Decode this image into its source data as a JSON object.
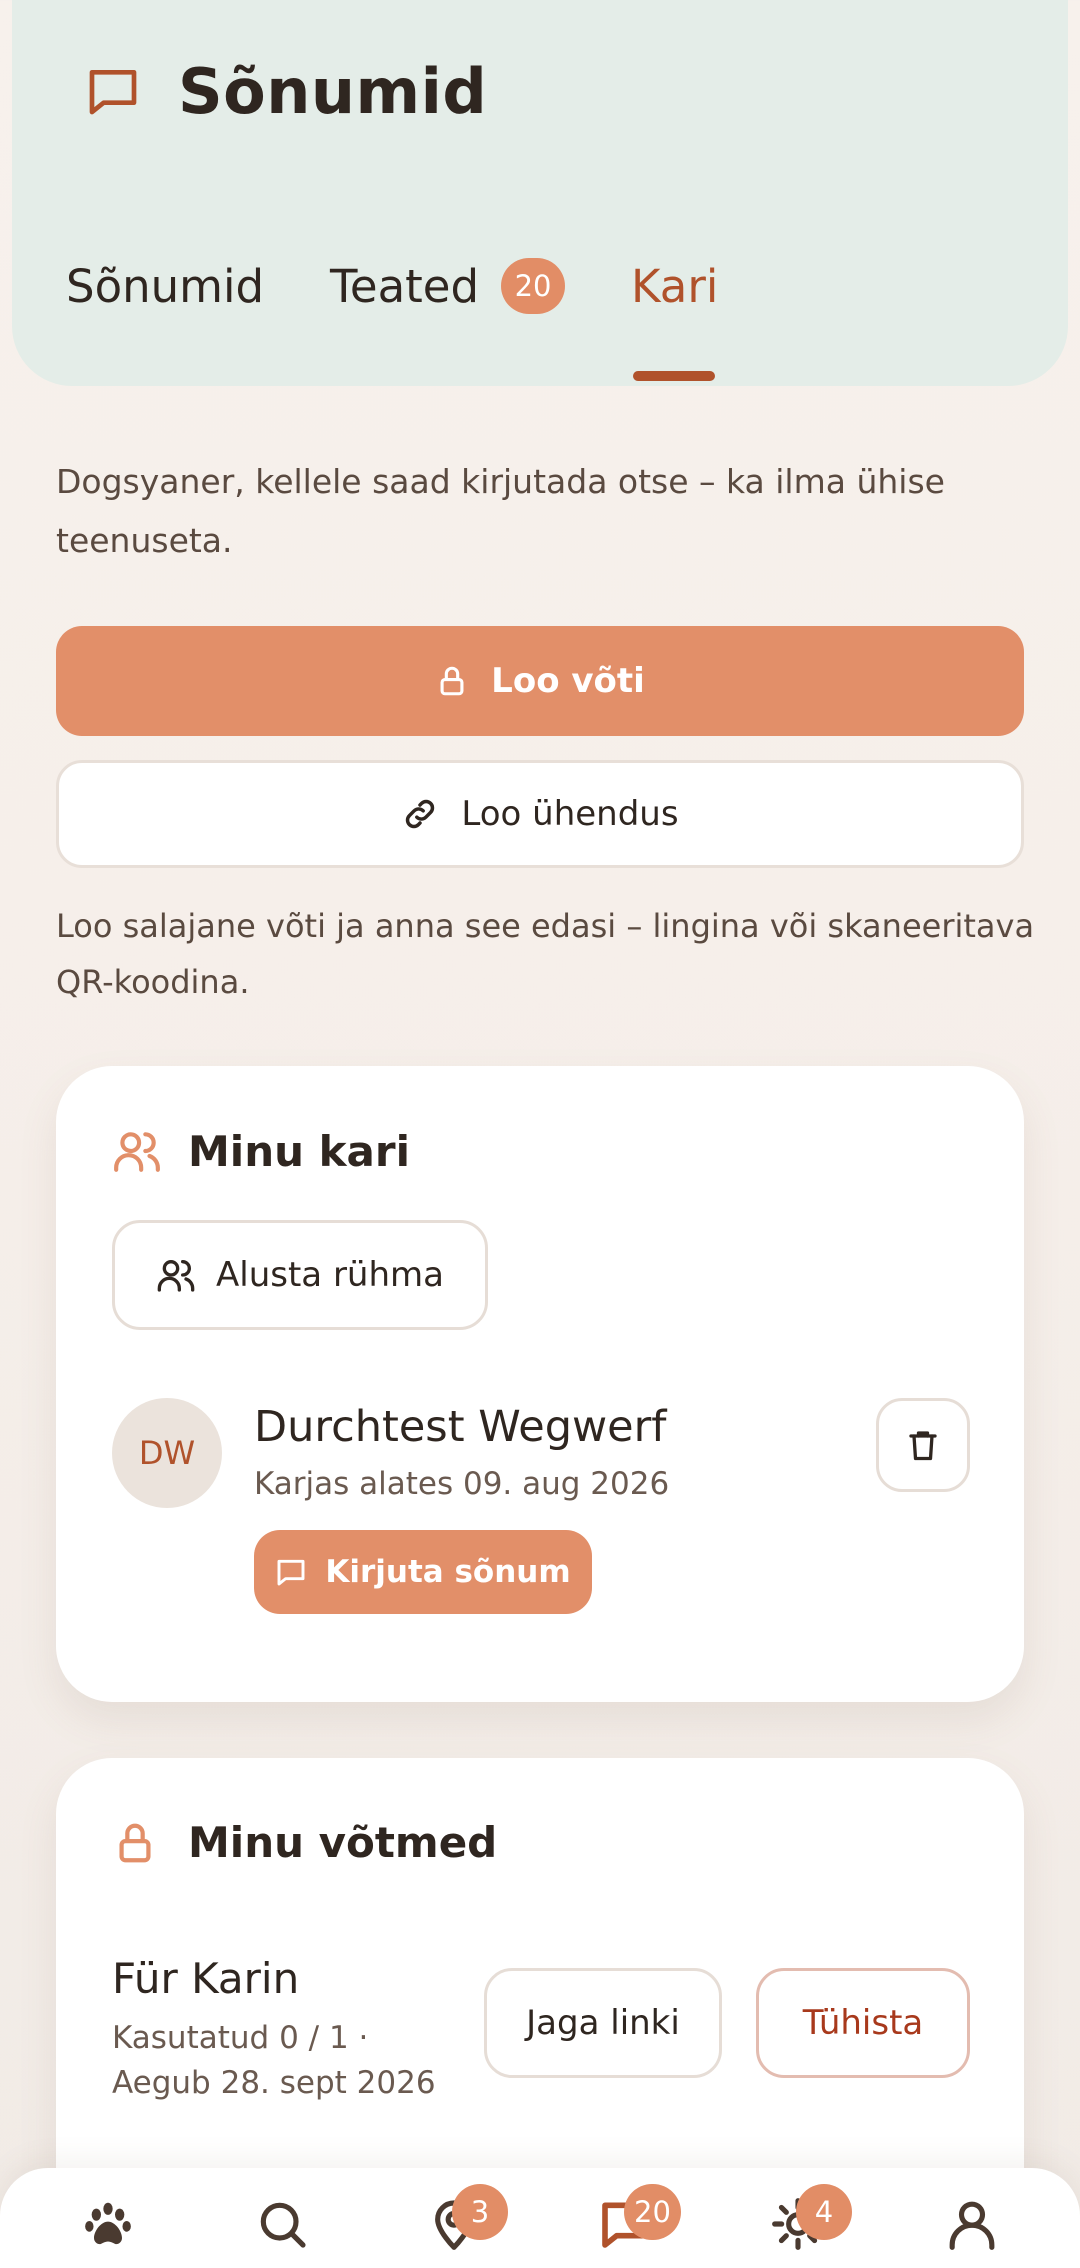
{
  "header": {
    "title": "Sõnumid",
    "tabs": [
      {
        "label": "Sõnumid",
        "active": false
      },
      {
        "label": "Teated",
        "badge": "20",
        "active": false
      },
      {
        "label": "Kari",
        "active": true
      }
    ]
  },
  "intro": "Dogsyaner, kellele saad kirjutada otse – ka ilma ühise teenuseta.",
  "actions": {
    "create_key_label": "Loo võti",
    "create_connection_label": "Loo ühendus"
  },
  "hint": "Loo salajane võti ja anna see edasi – lingina või skaneeritava QR-koodina.",
  "my_pack": {
    "title": "Minu kari",
    "start_group_label": "Alusta rühma",
    "members": [
      {
        "initials": "DW",
        "name": "Durchtest Wegwerf",
        "since": "Karjas alates 09. aug 2026",
        "write_label": "Kirjuta sõnum"
      }
    ]
  },
  "my_keys": {
    "title": "Minu võtmed",
    "keys": [
      {
        "name": "Für Karin",
        "usage": "Kasutatud 0 / 1 ·",
        "expires": "Aegub 28. sept 2026",
        "share_label": "Jaga linki",
        "cancel_label": "Tühista"
      }
    ]
  },
  "bottom_nav": {
    "items": [
      {
        "icon": "paw-icon"
      },
      {
        "icon": "search-icon"
      },
      {
        "icon": "map-pin-icon",
        "badge": "3"
      },
      {
        "icon": "message-icon",
        "badge": "20",
        "active": true
      },
      {
        "icon": "sun-icon",
        "badge": "4"
      },
      {
        "icon": "user-icon"
      }
    ]
  },
  "colors": {
    "accent": "#e28f69",
    "accent_dark": "#b0522b",
    "header_bg": "#e4ede8",
    "text": "#2f2620"
  }
}
